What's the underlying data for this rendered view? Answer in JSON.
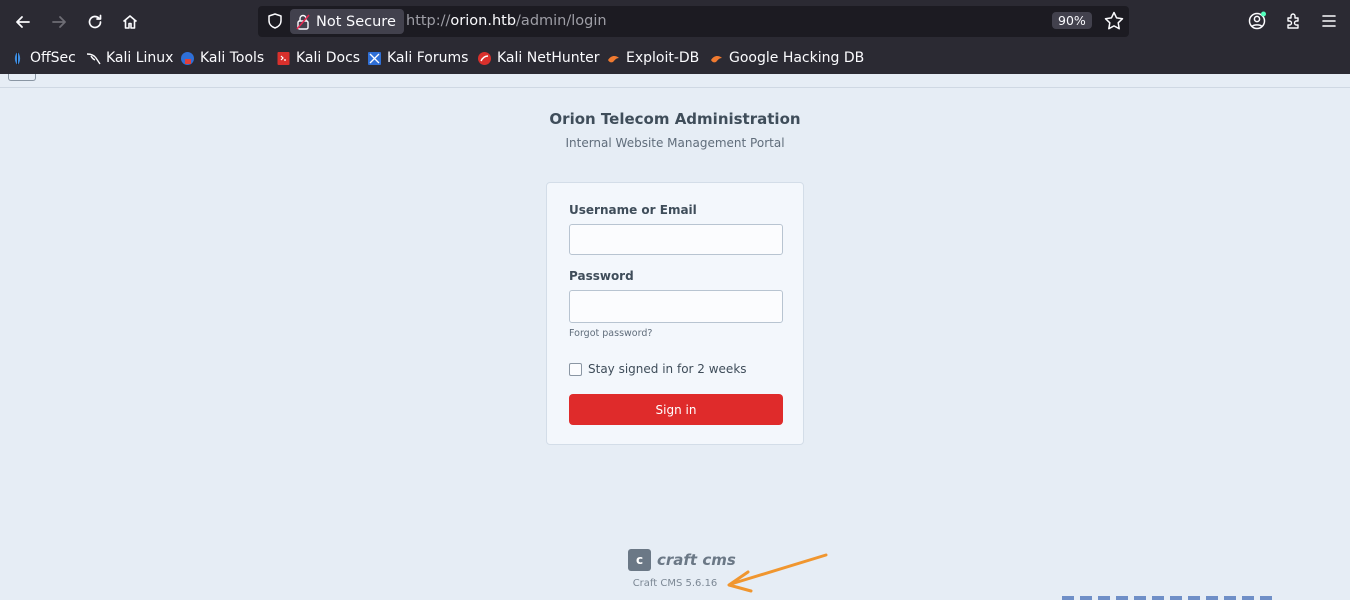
{
  "browser": {
    "not_secure_label": "Not Secure",
    "url_prefix": "http://",
    "url_host": "orion.htb",
    "url_path": "/admin/login",
    "zoom": "90%"
  },
  "bookmarks": [
    {
      "label": "OffSec",
      "icon": "offsec-icon"
    },
    {
      "label": "Kali Linux",
      "icon": "kali-dragon-icon"
    },
    {
      "label": "Kali Tools",
      "icon": "kali-tools-icon"
    },
    {
      "label": "Kali Docs",
      "icon": "kali-docs-icon"
    },
    {
      "label": "Kali Forums",
      "icon": "kali-forums-icon"
    },
    {
      "label": "Kali NetHunter",
      "icon": "nethunter-icon"
    },
    {
      "label": "Exploit-DB",
      "icon": "exploit-db-icon"
    },
    {
      "label": "Google Hacking DB",
      "icon": "ghdb-icon"
    }
  ],
  "login": {
    "title": "Orion Telecom Administration",
    "subtitle": "Internal Website Management Portal",
    "username_label": "Username or Email",
    "username_value": "",
    "password_label": "Password",
    "password_value": "",
    "forgot_label": "Forgot password?",
    "remember_label": "Stay signed in for 2 weeks",
    "remember_checked": false,
    "sign_in_label": "Sign in"
  },
  "footer": {
    "logo_letter": "c",
    "logo_text": "craft cms",
    "version": "Craft CMS 5.6.16"
  },
  "colors": {
    "accent": "#df2b2b",
    "page_bg": "#e6edf5",
    "annotation_arrow": "#f0962f",
    "browser_chrome": "#2b2a33"
  }
}
